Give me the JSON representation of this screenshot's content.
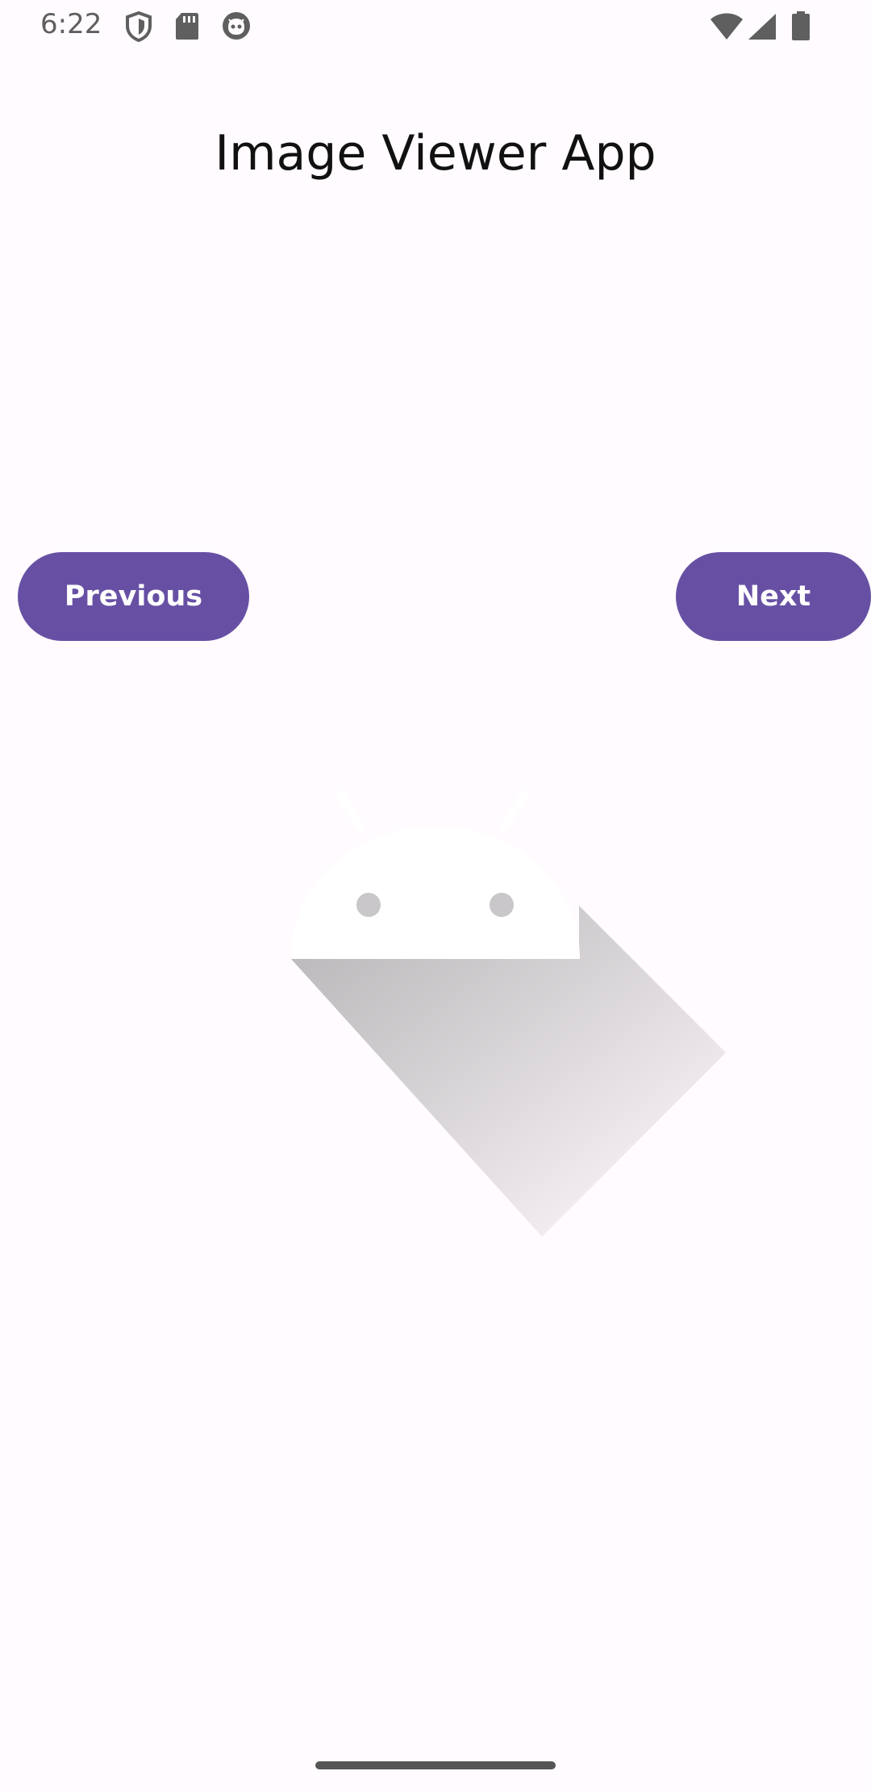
{
  "status_bar": {
    "time": "6:22",
    "icons": [
      "shield-icon",
      "sd-card-icon",
      "notification-face-icon",
      "wifi-icon",
      "signal-icon",
      "battery-icon"
    ],
    "icon_color": "#5f5f5f"
  },
  "app": {
    "title": "Image Viewer App"
  },
  "buttons": {
    "previous_label": "Previous",
    "next_label": "Next",
    "color": "#6750a4"
  },
  "image": {
    "icon": "android-logo-icon"
  }
}
